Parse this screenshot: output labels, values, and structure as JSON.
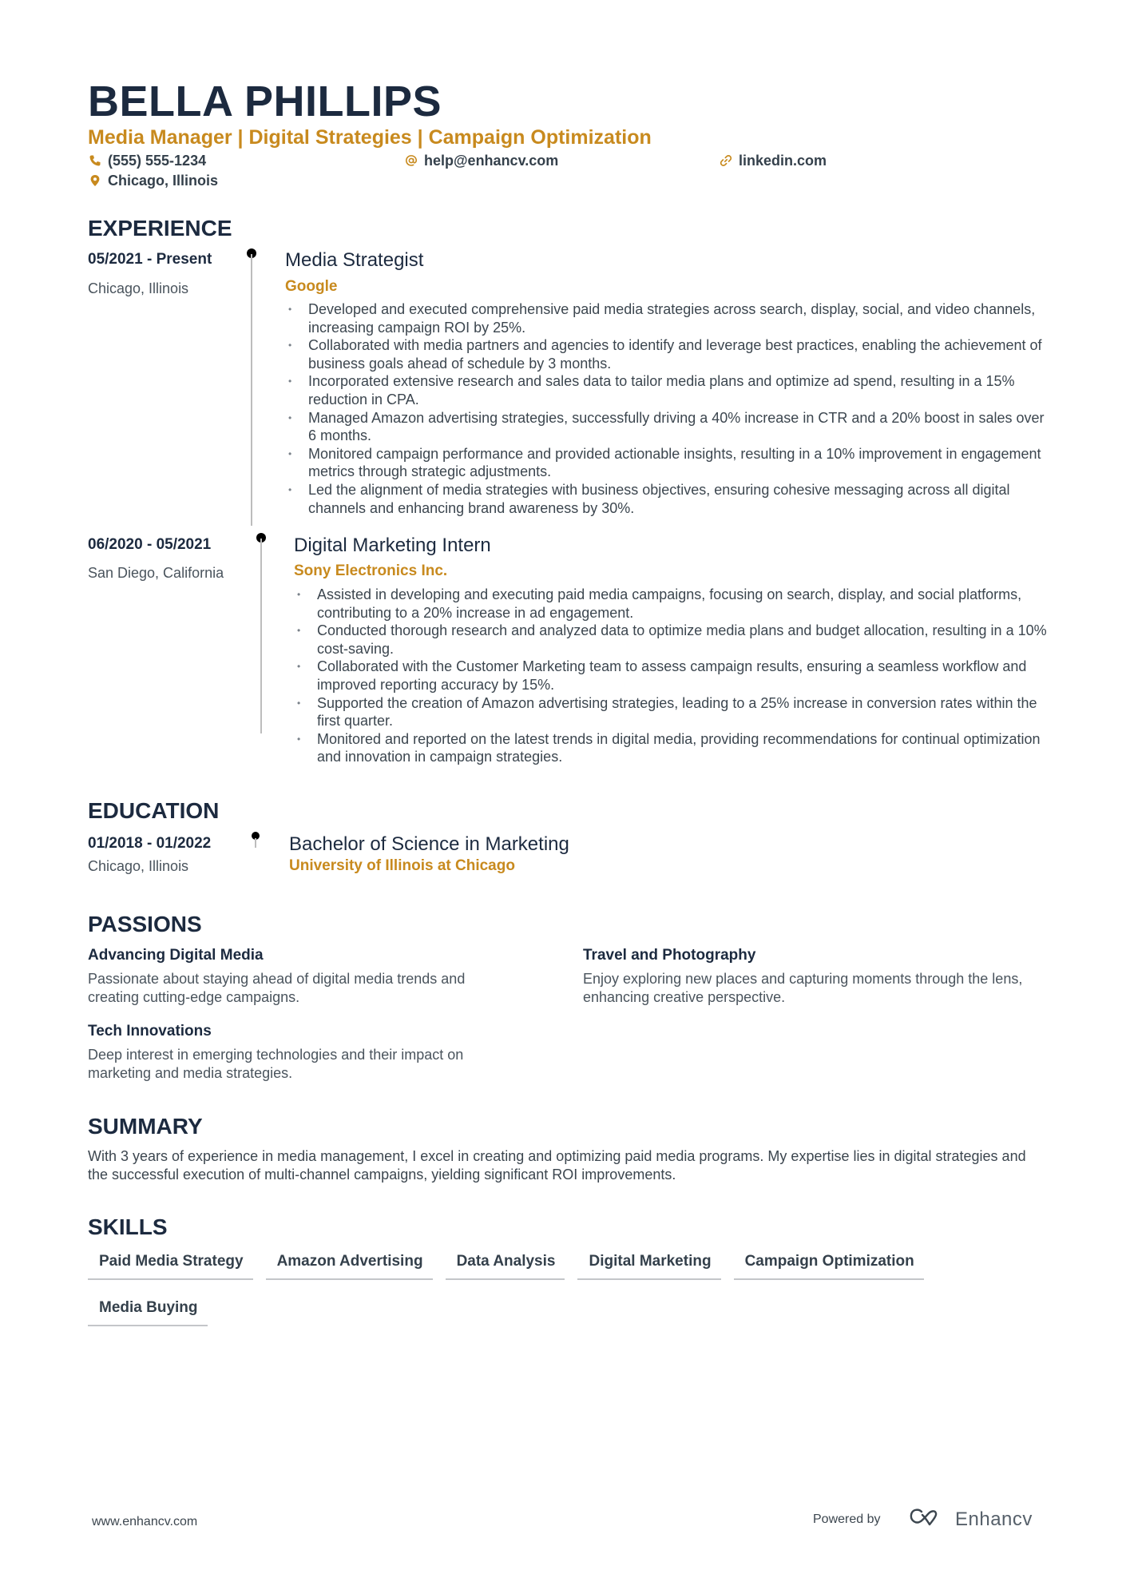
{
  "header": {
    "name": "BELLA PHILLIPS",
    "title": "Media Manager | Digital Strategies | Campaign Optimization",
    "contacts": {
      "phone": {
        "icon": "phone-icon",
        "value": "(555) 555-1234"
      },
      "email": {
        "icon": "at-icon",
        "value": "help@enhancv.com"
      },
      "linkedin": {
        "icon": "link-icon",
        "value": "linkedin.com"
      },
      "location": {
        "icon": "location-pin-icon",
        "value": "Chicago, Illinois"
      }
    }
  },
  "colors": {
    "accent": "#c88a1e",
    "heading": "#1c2a3f",
    "text": "#3c464f",
    "timeline": "#bdbdbd"
  },
  "experience": {
    "heading": "EXPERIENCE",
    "items": [
      {
        "dates": "05/2021 - Present",
        "location": "Chicago, Illinois",
        "role": "Media Strategist",
        "company": "Google",
        "bullets": [
          "Developed and executed comprehensive paid media strategies across search, display, social, and video channels, increasing campaign ROI by 25%.",
          "Collaborated with media partners and agencies to identify and leverage best practices, enabling the achievement of business goals ahead of schedule by 3 months.",
          "Incorporated extensive research and sales data to tailor media plans and optimize ad spend, resulting in a 15% reduction in CPA.",
          "Managed Amazon advertising strategies, successfully driving a 40% increase in CTR and a 20% boost in sales over 6 months.",
          "Monitored campaign performance and provided actionable insights, resulting in a 10% improvement in engagement metrics through strategic adjustments.",
          "Led the alignment of media strategies with business objectives, ensuring cohesive messaging across all digital channels and enhancing brand awareness by 30%."
        ]
      },
      {
        "dates": "06/2020 - 05/2021",
        "location": "San Diego, California",
        "role": "Digital Marketing Intern",
        "company": "Sony Electronics Inc.",
        "bullets": [
          "Assisted in developing and executing paid media campaigns, focusing on search, display, and social platforms, contributing to a 20% increase in ad engagement.",
          "Conducted thorough research and analyzed data to optimize media plans and budget allocation, resulting in a 10% cost-saving.",
          "Collaborated with the Customer Marketing team to assess campaign results, ensuring a seamless workflow and improved reporting accuracy by 15%.",
          "Supported the creation of Amazon advertising strategies, leading to a 25% increase in conversion rates within the first quarter.",
          "Monitored and reported on the latest trends in digital media, providing recommendations for continual optimization and innovation in campaign strategies."
        ]
      }
    ]
  },
  "education": {
    "heading": "EDUCATION",
    "items": [
      {
        "dates": "01/2018 - 01/2022",
        "location": "Chicago, Illinois",
        "degree": "Bachelor of Science in Marketing",
        "school": "University of Illinois at Chicago"
      }
    ]
  },
  "passions": {
    "heading": "PASSIONS",
    "items": [
      {
        "title": "Advancing Digital Media",
        "description": "Passionate about staying ahead of digital media trends and creating cutting-edge campaigns."
      },
      {
        "title": "Travel and Photography",
        "description": "Enjoy exploring new places and capturing moments through the lens, enhancing creative perspective."
      },
      {
        "title": "Tech Innovations",
        "description": "Deep interest in emerging technologies and their impact on marketing and media strategies."
      }
    ]
  },
  "summary": {
    "heading": "SUMMARY",
    "text": "With 3 years of experience in media management, I excel in creating and optimizing paid media programs. My expertise lies in digital strategies and the successful execution of multi-channel campaigns, yielding significant ROI improvements."
  },
  "skills": {
    "heading": "SKILLS",
    "items": [
      "Paid Media Strategy",
      "Amazon Advertising",
      "Data Analysis",
      "Digital Marketing",
      "Campaign Optimization",
      "Media Buying"
    ]
  },
  "footer": {
    "url": "www.enhancv.com",
    "powered_by": "Powered by",
    "brand": "Enhancv",
    "brand_icon": "enhancv-logo-icon"
  }
}
